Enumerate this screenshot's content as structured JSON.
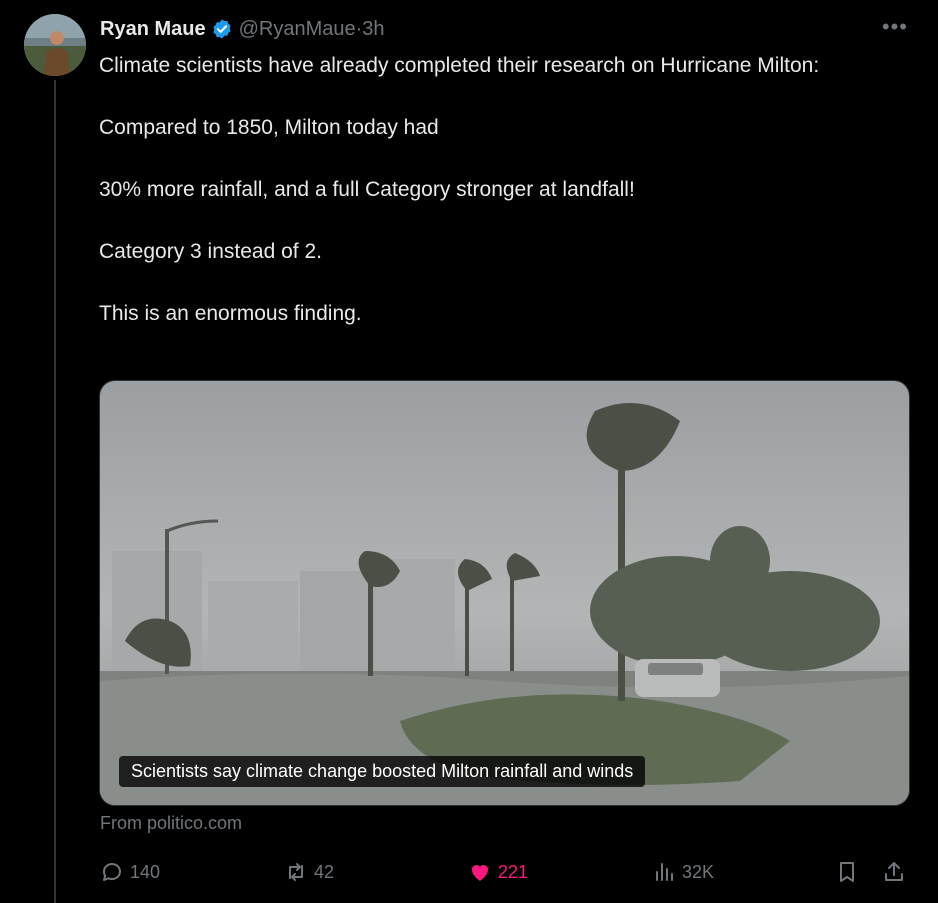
{
  "tweet": {
    "author_name": "Ryan Maue",
    "handle": "@RyanMaue",
    "time_sep": " · ",
    "time": "3h",
    "more_label": "•••",
    "lines": [
      "Climate scientists have already completed their research on Hurricane Milton:",
      "Compared to 1850, Milton today had",
      "30% more rainfall, and a full Category stronger at landfall!",
      "Category 3 instead of 2.",
      "This is an enormous finding."
    ]
  },
  "card": {
    "caption": "Scientists say climate change boosted Milton rainfall and winds",
    "source": "From politico.com"
  },
  "actions": {
    "replies": "140",
    "reposts": "42",
    "likes": "221",
    "views": "32K"
  },
  "colors": {
    "background": "#000000",
    "text": "#e7e9ea",
    "muted": "#71767b",
    "verified": "#1d9bf0",
    "like": "#f91880"
  },
  "icons": [
    "verified-badge-icon",
    "more-icon",
    "reply-icon",
    "repost-icon",
    "like-icon",
    "views-icon",
    "bookmark-icon",
    "share-icon"
  ]
}
